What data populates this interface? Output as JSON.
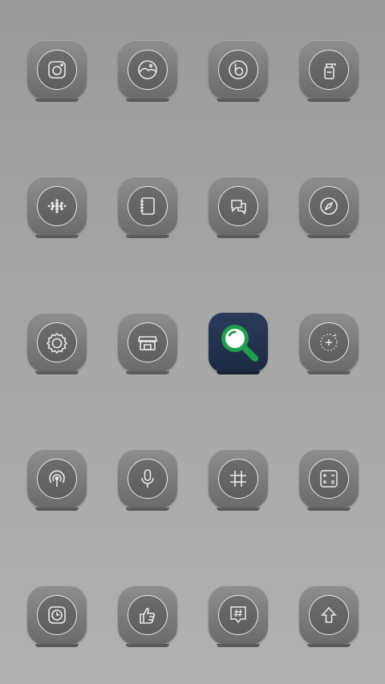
{
  "screen": {
    "background": "#a5a5a5",
    "rows": [
      [
        {
          "icon": "camera-icon"
        },
        {
          "icon": "gallery-icon"
        },
        {
          "icon": "music-player-icon"
        },
        {
          "icon": "cleaner-bottle-icon"
        }
      ],
      [
        {
          "icon": "dots-grid-icon"
        },
        {
          "icon": "notebook-icon"
        },
        {
          "icon": "chat-bubbles-icon"
        },
        {
          "icon": "compass-icon"
        }
      ],
      [
        {
          "icon": "settings-gear-icon"
        },
        {
          "icon": "store-icon"
        },
        {
          "icon": "search-magnifier-icon",
          "accent": "#1f9e4e",
          "tile_color": "#223350"
        },
        {
          "icon": "sparkle-clock-icon"
        }
      ],
      [
        {
          "icon": "podcast-icon"
        },
        {
          "icon": "microphone-icon"
        },
        {
          "icon": "hashtag-icon"
        },
        {
          "icon": "calculator-icon"
        }
      ],
      [
        {
          "icon": "clock-square-icon"
        },
        {
          "icon": "thumbs-up-icon"
        },
        {
          "icon": "hash-message-icon"
        },
        {
          "icon": "upload-arrow-icon"
        }
      ]
    ]
  }
}
